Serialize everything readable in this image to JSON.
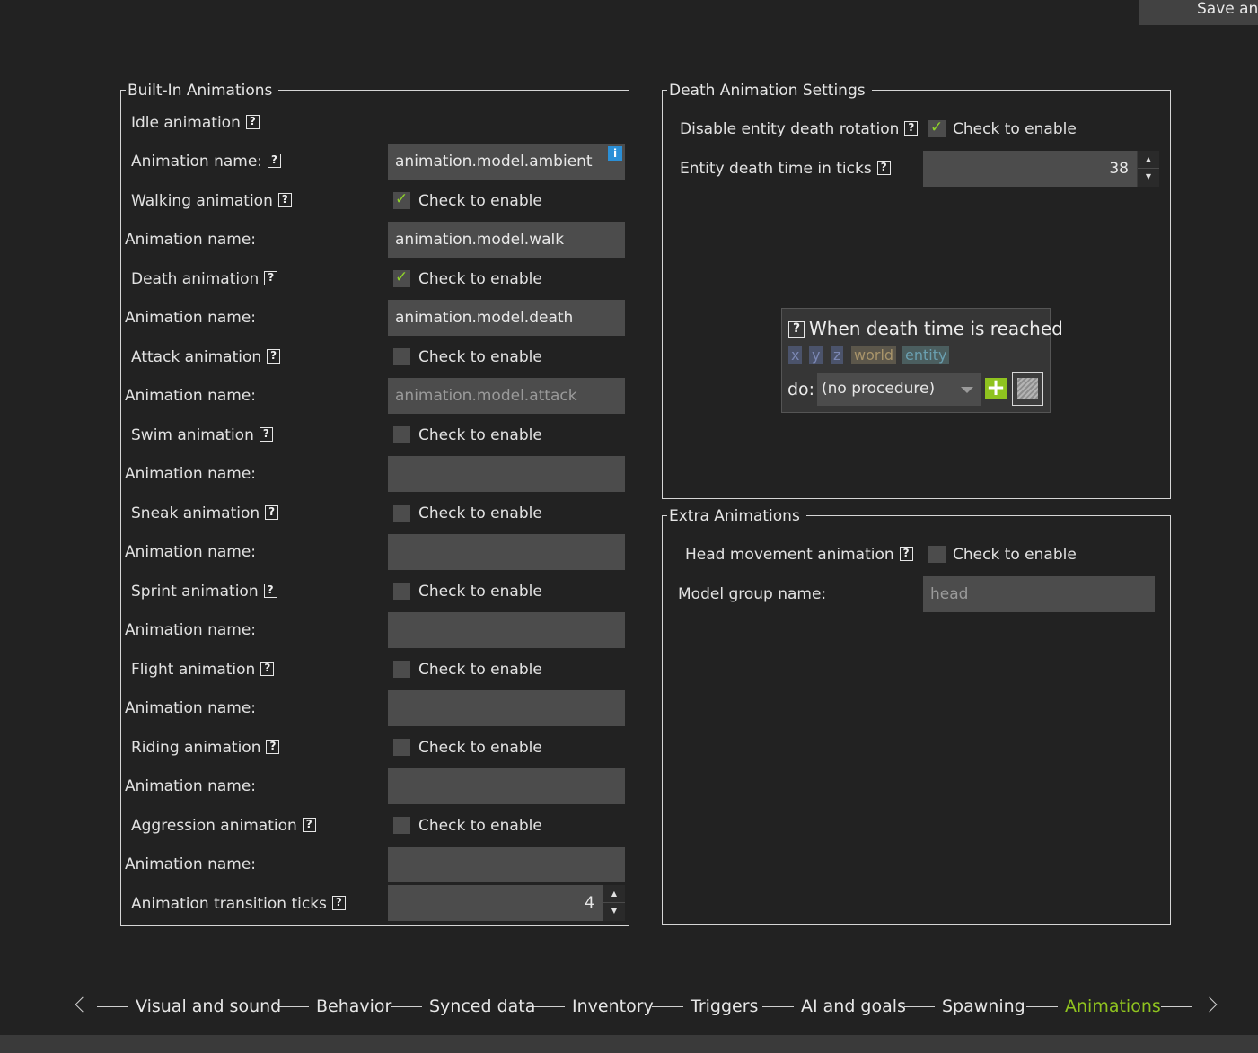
{
  "toolbar": {
    "save_label": "Save and"
  },
  "builtin": {
    "title": "Built-In Animations",
    "idle_label": "Idle animation",
    "idle_name_label": "Animation name:",
    "idle_name_value": "animation.model.ambient",
    "rows": [
      {
        "label": "Walking animation",
        "checked": true,
        "check_label": "Check to enable",
        "name_label": "Animation name:",
        "name_value": "animation.model.walk"
      },
      {
        "label": "Death animation",
        "checked": true,
        "check_label": "Check to enable",
        "name_label": "Animation name:",
        "name_value": "animation.model.death"
      },
      {
        "label": "Attack animation",
        "checked": false,
        "check_label": "Check to enable",
        "name_label": "Animation name:",
        "name_value": "animation.model.attack"
      },
      {
        "label": "Swim animation",
        "checked": false,
        "check_label": "Check to enable",
        "name_label": "Animation name:",
        "name_value": ""
      },
      {
        "label": "Sneak animation",
        "checked": false,
        "check_label": "Check to enable",
        "name_label": "Animation name:",
        "name_value": ""
      },
      {
        "label": "Sprint animation",
        "checked": false,
        "check_label": "Check to enable",
        "name_label": "Animation name:",
        "name_value": ""
      },
      {
        "label": "Flight animation",
        "checked": false,
        "check_label": "Check to enable",
        "name_label": "Animation name:",
        "name_value": ""
      },
      {
        "label": "Riding animation",
        "checked": false,
        "check_label": "Check to enable",
        "name_label": "Animation name:",
        "name_value": ""
      },
      {
        "label": "Aggression animation",
        "checked": false,
        "check_label": "Check to enable",
        "name_label": "Animation name:",
        "name_value": ""
      }
    ],
    "transition_label": "Animation transition ticks",
    "transition_value": "4"
  },
  "death": {
    "title": "Death Animation Settings",
    "disable_rotation_label": "Disable entity death rotation",
    "disable_rotation_checked": true,
    "check_label": "Check to enable",
    "death_time_label": "Entity death time in ticks",
    "death_time_value": "38",
    "procedure": {
      "title": "When death time is reached",
      "deps": [
        "x",
        "y",
        "z",
        "world",
        "entity"
      ],
      "do_label": "do:",
      "selected": "(no procedure)"
    }
  },
  "extra": {
    "title": "Extra Animations",
    "head_label": "Head movement animation",
    "head_checked": false,
    "check_label": "Check to enable",
    "group_label": "Model group name:",
    "group_value": "head"
  },
  "nav": {
    "tabs": [
      "Visual and sound",
      "Behavior",
      "Synced data",
      "Inventory",
      "Triggers",
      "AI and goals",
      "Spawning",
      "Animations"
    ],
    "active": "Animations"
  },
  "colors": {
    "accent": "#8fc31f",
    "background": "#222222",
    "field": "#4c4c4c"
  }
}
